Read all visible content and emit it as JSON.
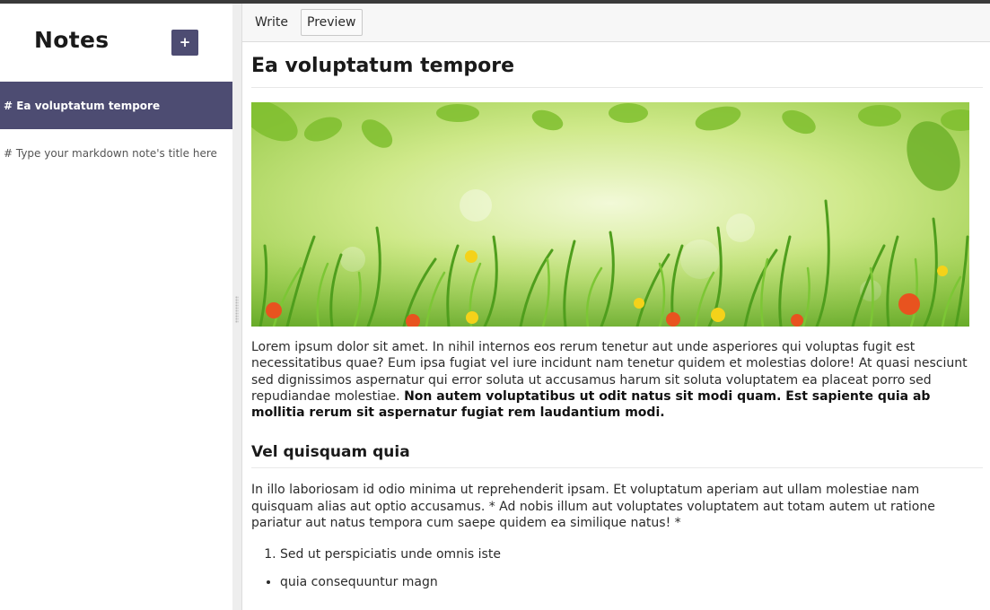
{
  "sidebar": {
    "title": "Notes",
    "add_label": "+",
    "notes": [
      {
        "label": "# Ea voluptatum tempore",
        "active": true
      },
      {
        "label": "# Type your markdown note's title here",
        "active": false
      }
    ]
  },
  "tabs": {
    "write": "Write",
    "preview": "Preview",
    "active": "Preview"
  },
  "document": {
    "title": "Ea voluptatum tempore",
    "paragraph1": "Lorem ipsum dolor sit amet. In nihil internos eos rerum tenetur aut unde asperiores qui voluptas fugit est necessitatibus quae? Eum ipsa fugiat vel iure incidunt nam tenetur quidem et molestias dolore! At quasi nesciunt sed dignissimos aspernatur qui error soluta ut accusamus harum sit soluta voluptatem ea placeat porro sed repudiandae molestiae. ",
    "paragraph1_bold": "Non autem voluptatibus ut odit natus sit modi quam. Est sapiente quia ab mollitia rerum sit aspernatur fugiat rem laudantium modi.",
    "heading2": "Vel quisquam quia",
    "paragraph2": "In illo laboriosam id odio minima ut reprehenderit ipsam. Et voluptatum aperiam aut ullam molestiae nam quisquam alias aut optio accusamus. * Ad nobis illum aut voluptates voluptatem aut totam autem ut ratione pariatur aut natus tempora cum saepe quidem ea similique natus! *",
    "ordered_item": "Sed ut perspiciatis unde omnis iste",
    "bullet_item": "quia consequuntur magn"
  },
  "colors": {
    "accent": "#4d4c72",
    "topbar": "#3a3a3a"
  }
}
